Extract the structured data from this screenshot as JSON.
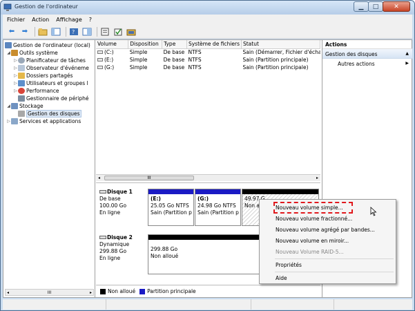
{
  "window": {
    "title": "Gestion de l'ordinateur"
  },
  "menu": [
    "Fichier",
    "Action",
    "Affichage",
    "?"
  ],
  "tree": {
    "root": "Gestion de l'ordinateur (local)",
    "outils": "Outils système",
    "planificateur": "Planificateur de tâches",
    "observateur": "Observateur d'événeme",
    "dossiers": "Dossiers partagés",
    "utilisateurs": "Utilisateurs et groupes l",
    "performance": "Performance",
    "gestionnaire": "Gestionnaire de périphé",
    "stockage": "Stockage",
    "gestion_disques": "Gestion des disques",
    "services": "Services et applications"
  },
  "volume_table": {
    "headers": [
      "Volume",
      "Disposition",
      "Type",
      "Système de fichiers",
      "Statut"
    ],
    "rows": [
      [
        "(C:)",
        "Simple",
        "De base",
        "NTFS",
        "Sain (Démarrer, Fichier d'échar"
      ],
      [
        "(E:)",
        "Simple",
        "De base",
        "NTFS",
        "Sain (Partition principale)"
      ],
      [
        "(G:)",
        "Simple",
        "De base",
        "NTFS",
        "Sain (Partition principale)"
      ]
    ],
    "scroll_label": "III"
  },
  "disk1": {
    "name": "Disque 1",
    "type": "De base",
    "size": "100.00 Go",
    "state": "En ligne",
    "partitions": [
      {
        "name": "(E:)",
        "size": "25.05 Go NTFS",
        "status": "Sain (Partition p"
      },
      {
        "name": "(G:)",
        "size": "24.98 Go NTFS",
        "status": "Sain (Partition p"
      },
      {
        "name": "",
        "size": "49.97 G",
        "status": "Non a"
      }
    ]
  },
  "disk2": {
    "name": "Disque 2",
    "type": "Dynamique",
    "size": "299.88 Go",
    "state": "En ligne",
    "partition": {
      "size": "299.88 Go",
      "status": "Non alloué"
    }
  },
  "legend": {
    "unallocated": "Non alloué",
    "primary": "Partition principale"
  },
  "actions": {
    "header": "Actions",
    "section": "Gestion des disques",
    "item": "Autres actions"
  },
  "context_menu": {
    "items": [
      "Nouveau volume simple...",
      "Nouveau volume fractionné...",
      "Nouveau volume agrégé par bandes...",
      "Nouveau volume en miroir...",
      "Nouveau Volume RAID-5...",
      "Propriétés",
      "Aide"
    ]
  },
  "colors": {
    "primary_partition": "#1a1ac4",
    "unallocated": "#000000",
    "highlight": "#e0181c"
  }
}
